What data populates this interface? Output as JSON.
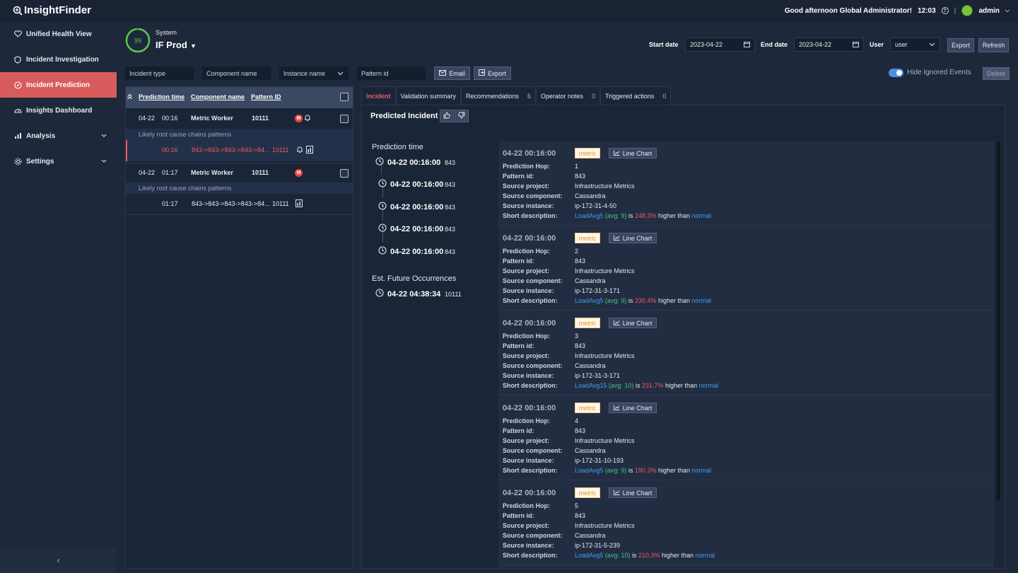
{
  "app": {
    "logo": "InsightFinder",
    "greeting": "Good afternoon Global Administrator!",
    "clock": "12:03",
    "user": "admin"
  },
  "sidebar": {
    "items": [
      {
        "label": "Unified Health View",
        "icon": "heart-pulse-icon"
      },
      {
        "label": "Incident Investigation",
        "icon": "shield-icon"
      },
      {
        "label": "Incident Prediction",
        "icon": "compass-icon",
        "active": true
      },
      {
        "label": "Insights Dashboard",
        "icon": "dashboard-gauge-icon"
      },
      {
        "label": "Analysis",
        "icon": "bar-chart-icon",
        "expandable": true
      },
      {
        "label": "Settings",
        "icon": "gear-icon",
        "expandable": true
      }
    ],
    "collapse_glyph": "‹"
  },
  "header": {
    "health_score": "99",
    "system_label": "System",
    "system_name": "IF Prod",
    "start_date_label": "Start date",
    "start_date": "2023-04-22",
    "end_date_label": "End date",
    "end_date": "2023-04-22",
    "user_label": "User",
    "user_value": "user",
    "export": "Export",
    "refresh": "Refresh"
  },
  "filters": {
    "incident_type": "Incident type",
    "component_name": "Component name",
    "instance_name": "Instance name",
    "pattern_id": "Pattern id",
    "email": "Email",
    "export": "Export",
    "hide_ignored": "Hide Ignored Events",
    "delete": "Delete"
  },
  "list": {
    "headers": {
      "prediction_time": "Prediction time",
      "component_name": "Component name",
      "pattern_id": "Pattern ID"
    },
    "groups": [
      {
        "date": "04-22",
        "time": "00:16",
        "component": "Metric Worker",
        "pattern": "10111",
        "badge": "M",
        "sub_label": "Likely root cause chains patterns",
        "chain": {
          "time": "00:16",
          "path": "843->843->843->843->84...",
          "pattern": "10111"
        }
      },
      {
        "date": "04-22",
        "time": "01:17",
        "component": "Metric Worker",
        "pattern": "10111",
        "badge": "M",
        "sub_label": "Likely root cause chains patterns",
        "chain": {
          "time": "01:17",
          "path": "843->843->843->843->84...",
          "pattern": "10111"
        }
      }
    ]
  },
  "tabs": [
    {
      "label": "Incident",
      "count": ""
    },
    {
      "label": "Validation summary",
      "count": ""
    },
    {
      "label": "Recommendations",
      "count": "6"
    },
    {
      "label": "Operator notes",
      "count": "0"
    },
    {
      "label": "Triggered actions",
      "count": "0"
    }
  ],
  "incident": {
    "title": "Predicted Incident",
    "prediction_time_label": "Prediction time",
    "timeline": [
      {
        "time": "04-22 00:16:00",
        "pattern": "843"
      },
      {
        "time": "04-22 00:16:00",
        "pattern": "843"
      },
      {
        "time": "04-22 00:16:00",
        "pattern": "843"
      },
      {
        "time": "04-22 00:16:00",
        "pattern": "843"
      },
      {
        "time": "04-22 00:16:00",
        "pattern": "843"
      }
    ],
    "future_label": "Est. Future Occurrences",
    "future": {
      "time": "04-22 04:38:34",
      "pattern": "10111"
    },
    "field_labels": {
      "hop": "Prediction Hop:",
      "pattern": "Pattern id:",
      "project": "Source project:",
      "component": "Source component:",
      "instance": "Source instance:",
      "desc": "Short description:"
    },
    "tag_label": "metric",
    "line_chart_label": "Line Chart",
    "cards": [
      {
        "time": "04-22 00:16:00",
        "hop": "1",
        "pattern": "843",
        "project": "Infrastructure Metrics",
        "component": "Cassandra",
        "instance": "ip-172-31-4-50",
        "metric": "LoadAvg5",
        "avg": "(avg: 9)",
        "is": "is",
        "pct": "248.3%",
        "higher": "higher than",
        "normal": "normal"
      },
      {
        "time": "04-22 00:16:00",
        "hop": "2",
        "pattern": "843",
        "project": "Infrastructure Metrics",
        "component": "Cassandra",
        "instance": "ip-172-31-3-171",
        "metric": "LoadAvg5",
        "avg": "(avg: 9)",
        "is": "is",
        "pct": "230.4%",
        "higher": "higher than",
        "normal": "normal"
      },
      {
        "time": "04-22 00:16:00",
        "hop": "3",
        "pattern": "843",
        "project": "Infrastructure Metrics",
        "component": "Cassandra",
        "instance": "ip-172-31-3-171",
        "metric": "LoadAvg15",
        "avg": "(avg: 10)",
        "is": "is",
        "pct": "231.7%",
        "higher": "higher than",
        "normal": "normal"
      },
      {
        "time": "04-22 00:16:00",
        "hop": "4",
        "pattern": "843",
        "project": "Infrastructure Metrics",
        "component": "Cassandra",
        "instance": "ip-172-31-10-193",
        "metric": "LoadAvg5",
        "avg": "(avg: 9)",
        "is": "is",
        "pct": "190.3%",
        "higher": "higher than",
        "normal": "normal"
      },
      {
        "time": "04-22 00:16:00",
        "hop": "5",
        "pattern": "843",
        "project": "Infrastructure Metrics",
        "component": "Cassandra",
        "instance": "ip-172-31-5-239",
        "metric": "LoadAvg5",
        "avg": "(avg: 10)",
        "is": "is",
        "pct": "210.3%",
        "higher": "higher than",
        "normal": "normal"
      }
    ]
  },
  "colors": {
    "accent": "#d95c5c",
    "health_ring": "#5cc84a",
    "link": "#3ba0f0",
    "alert": "#f05a5a",
    "metric_tag": "#e8942c"
  }
}
